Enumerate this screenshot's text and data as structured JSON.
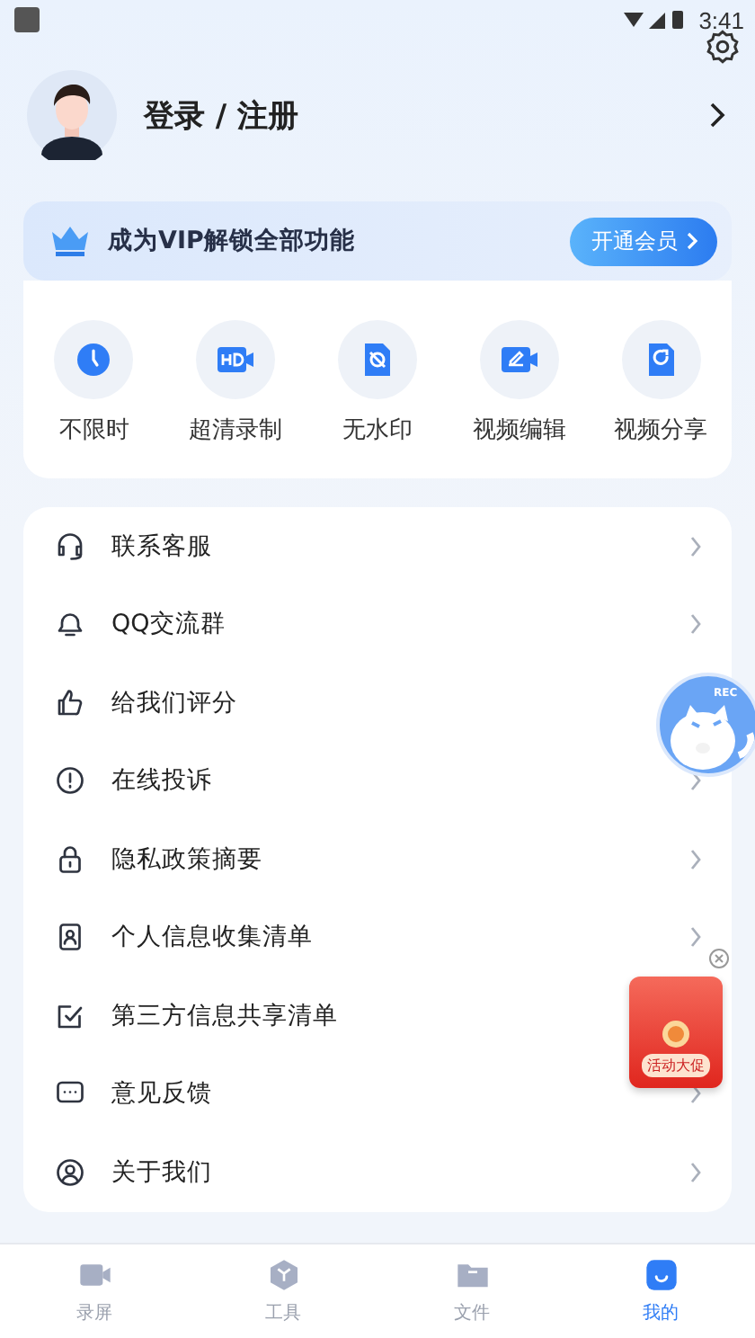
{
  "status_bar": {
    "time": "3:41"
  },
  "profile": {
    "title": "登录 / 注册"
  },
  "vip_banner": {
    "text": "成为VIP解锁全部功能",
    "button": "开通会员"
  },
  "features": [
    {
      "label": "不限时",
      "kind": "clock"
    },
    {
      "label": "超清录制",
      "kind": "hd"
    },
    {
      "label": "无水印",
      "kind": "nowatermark"
    },
    {
      "label": "视频编辑",
      "kind": "edit"
    },
    {
      "label": "视频分享",
      "kind": "share"
    }
  ],
  "menu": [
    {
      "label": "联系客服",
      "kind": "headset",
      "chevron": true
    },
    {
      "label": "QQ交流群",
      "kind": "qq",
      "chevron": true
    },
    {
      "label": "给我们评分",
      "kind": "thumb",
      "chevron": false
    },
    {
      "label": "在线投诉",
      "kind": "alert",
      "chevron": true
    },
    {
      "label": "隐私政策摘要",
      "kind": "lock",
      "chevron": true
    },
    {
      "label": "个人信息收集清单",
      "kind": "idcard",
      "chevron": true
    },
    {
      "label": "第三方信息共享清单",
      "kind": "note",
      "chevron": false
    },
    {
      "label": "意见反馈",
      "kind": "chat",
      "chevron": true
    },
    {
      "label": "关于我们",
      "kind": "user",
      "chevron": true
    }
  ],
  "floating_widget": {
    "label": "REC"
  },
  "promo": {
    "label": "活动大促"
  },
  "bottom_nav": [
    {
      "label": "录屏",
      "kind": "camera",
      "selected": false
    },
    {
      "label": "工具",
      "kind": "tools",
      "selected": false
    },
    {
      "label": "文件",
      "kind": "folder",
      "selected": false
    },
    {
      "label": "我的",
      "kind": "me",
      "selected": true
    }
  ]
}
